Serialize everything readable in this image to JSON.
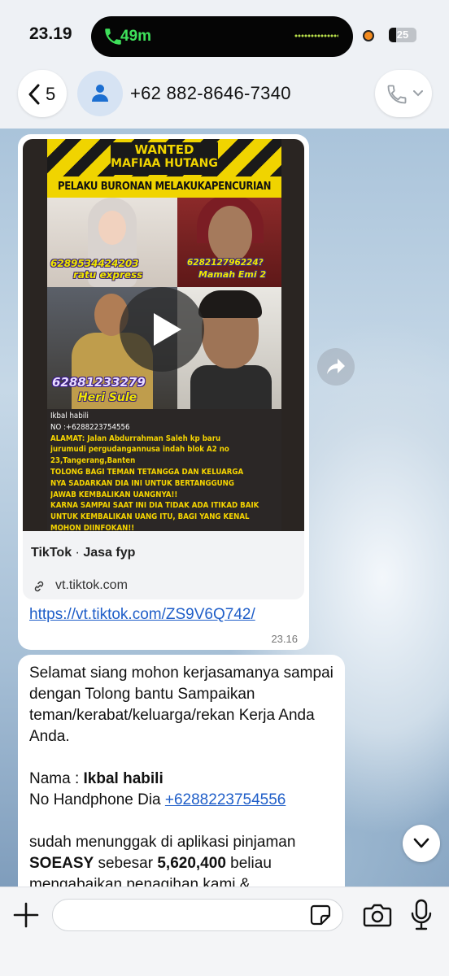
{
  "status_bar": {
    "time": "23.19",
    "call_duration": "49m",
    "battery_level": "25",
    "battery_fraction": 0.25
  },
  "header": {
    "back_count": "5",
    "contact_name": "+62 882-8646-7340"
  },
  "message1": {
    "preview": {
      "poster_title": "WANTED",
      "poster_title2": "MAFIAA HUTANG",
      "poster_subtitle": "PELAKU BURONAN MELAKUKAPENCURIAN UANG",
      "photo1_phone": "6289534424203",
      "photo1_name": "ratu express",
      "photo2_phone": "628212796224?",
      "photo2_name": "Mamah Emi 2",
      "photo3_phone": "62881233279",
      "photo3_name": "Heri Sule",
      "text_lines": [
        {
          "t": "Ikbal habili",
          "white": true
        },
        {
          "t": "NO :+6288223754556",
          "white": true
        },
        {
          "t": "ALAMAT: Jalan Abdurrahman Saleh kp baru",
          "white": false
        },
        {
          "t": "jurumudi pergudangannusa indah blok A2 no",
          "white": false
        },
        {
          "t": "23,Tangerang,Banten",
          "white": false
        },
        {
          "t": "TOLONG BAGI TEMAN TETANGGA DAN KELUARGA",
          "white": false
        },
        {
          "t": "NYA SADARKAN DIA INI UNTUK BERTANGGUNG",
          "white": false
        },
        {
          "t": "JAWAB KEMBALIKAN UANGNYA!!",
          "white": false
        },
        {
          "t": "KARNA SAMPAI SAAT INI DIA TIDAK ADA ITIKAD BAIK",
          "white": false
        },
        {
          "t": "UNTUK KEMBALIKAN UANG ITU, BAGI YANG KENAL",
          "white": false
        },
        {
          "t": "MOHON DIINFOKAN!!",
          "white": false
        }
      ],
      "source_name": "TikTok",
      "source_separator": "·",
      "source_author": "Jasa fyp",
      "domain": "vt.tiktok.com"
    },
    "url": "https://vt.tiktok.com/ZS9V6Q742/",
    "time": "23.16"
  },
  "message2": {
    "greeting": "Selamat siang  mohon kerjasamanya sampai dengan Tolong bantu Sampaikan teman/kerabat/keluarga/rekan Kerja Anda Anda.",
    "name_label": "Nama : ",
    "name_value": "Ikbal habili",
    "phone_label": "No Handphone Dia  ",
    "phone_value": "+6288223754556",
    "debt_prefix": "sudah menunggak di aplikasi pinjaman ",
    "app_name": "SOEASY",
    "debt_mid": " sebesar ",
    "amount": "5,620,400",
    "debt_suffix": " beliau mengabaikan penagihan kami &"
  },
  "compose": {
    "placeholder": ""
  },
  "icons": {
    "back": "chevron-left-icon",
    "avatar": "person-icon",
    "call": "phone-icon",
    "play": "play-icon",
    "forward": "forward-icon",
    "link": "link-icon",
    "scroll": "chevron-down-icon",
    "plus": "plus-icon",
    "sticker": "sticker-icon",
    "camera": "camera-icon",
    "mic": "microphone-icon"
  },
  "colors": {
    "link_blue": "#1f5ec8",
    "call_green": "#3ee05a",
    "poster_yellow": "#f0d400"
  }
}
